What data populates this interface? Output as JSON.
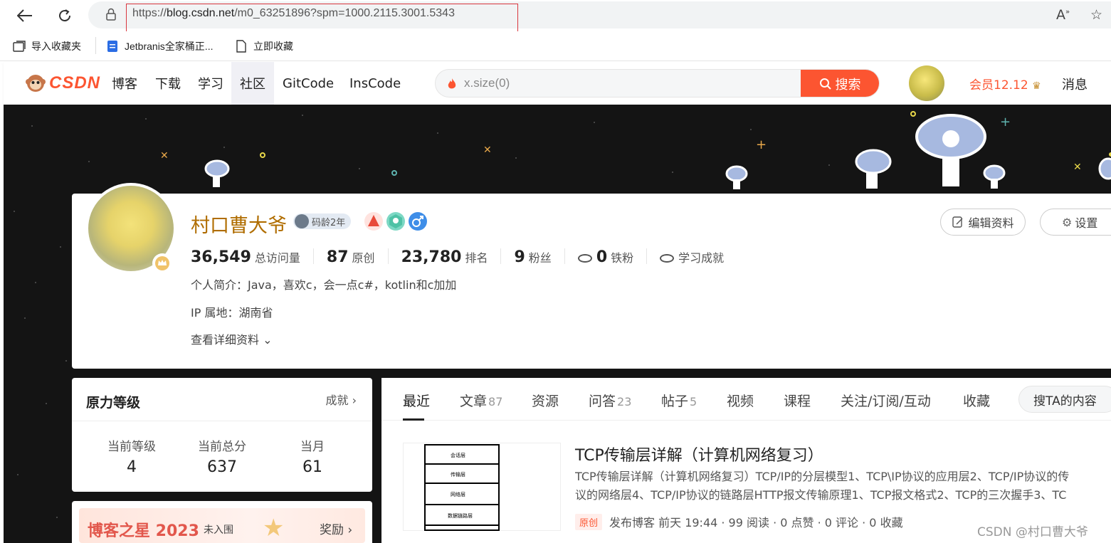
{
  "browser": {
    "url_prefix": "https://",
    "url_host": "blog.csdn.net",
    "url_path": "/m0_63251896?spm=1000.2115.3001.5343",
    "favorites": [
      "导入收藏夹",
      "Jetbranis全家桶正...",
      "立即收藏"
    ]
  },
  "toolbar": {
    "logo_text": "CSDN",
    "nav": [
      "博客",
      "下载",
      "学习",
      "社区",
      "GitCode",
      "InsCode"
    ],
    "search_placeholder": "x.size(0)",
    "search_button": "搜索",
    "vip": "会员12.12",
    "messages": "消息"
  },
  "profile": {
    "name": "村口曹大爷",
    "code_age": "码龄2年",
    "stats": [
      {
        "value": "36,549",
        "label": "总访问量"
      },
      {
        "value": "87",
        "label": "原创"
      },
      {
        "value": "23,780",
        "label": "排名"
      },
      {
        "value": "9",
        "label": "粉丝"
      },
      {
        "value": "0",
        "label": "铁粉"
      },
      {
        "value": "",
        "label": "学习成就"
      }
    ],
    "bio": "个人简介：Java，喜欢c，会一点c#，kotlin和c加加",
    "ip": "IP 属地：湖南省",
    "more": "查看详细资料",
    "edit_button": "编辑资料",
    "settings_button": "设置"
  },
  "level_card": {
    "title": "原力等级",
    "more": "成就",
    "cols": [
      {
        "label": "当前等级",
        "value": "4"
      },
      {
        "label": "当前总分",
        "value": "637"
      },
      {
        "label": "当月",
        "value": "61"
      }
    ]
  },
  "star_card": {
    "title": "博客之星 2023",
    "status": "未入围",
    "reward": "奖励"
  },
  "tabs": [
    {
      "label": "最近",
      "count": ""
    },
    {
      "label": "文章",
      "count": "87"
    },
    {
      "label": "资源",
      "count": ""
    },
    {
      "label": "问答",
      "count": "23"
    },
    {
      "label": "帖子",
      "count": "5"
    },
    {
      "label": "视频",
      "count": ""
    },
    {
      "label": "课程",
      "count": ""
    },
    {
      "label": "关注/订阅/互动",
      "count": ""
    },
    {
      "label": "收藏",
      "count": ""
    }
  ],
  "search_ta": "搜TA的内容",
  "article": {
    "title": "TCP传输层详解（计算机网络复习）",
    "desc1": "TCP传输层详解（计算机网络复习）TCP/IP的分层模型1、TCP\\IP协议的应用层2、TCP/IP协议的传",
    "desc2": "议的网络层4、TCP/IP协议的链路层HTTP报文传输原理1、TCP报文格式2、TCP的三次握手3、TC",
    "tag": "原创",
    "meta": "发布博客 前天 19:44 ·  99 阅读 ·  0 点赞 ·  0 评论 ·  0 收藏",
    "thumb_layers": [
      "会话层",
      "传输层",
      "网络层",
      "数据链路层"
    ]
  },
  "watermark": "CSDN @村口曹大爷",
  "colors": {
    "brand": "#fc5531",
    "username": "#b06d00"
  }
}
